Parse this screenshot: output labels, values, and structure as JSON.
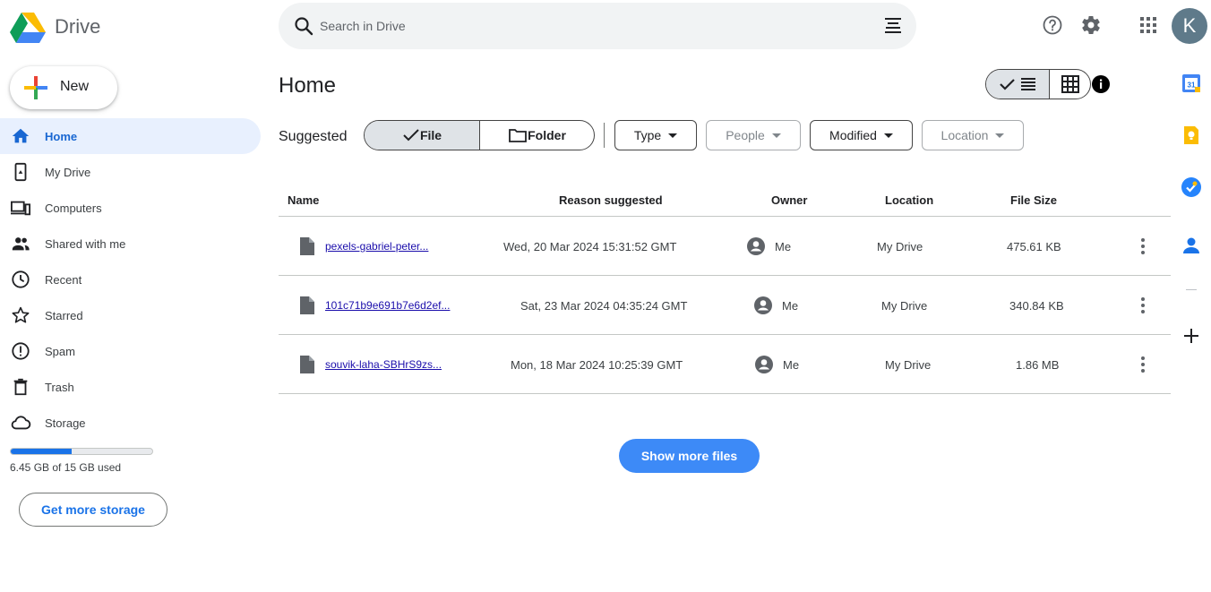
{
  "header": {
    "app_name": "Drive",
    "search_placeholder": "Search in Drive",
    "avatar_initial": "K"
  },
  "sidebar": {
    "new_label": "New",
    "items": [
      {
        "label": "Home",
        "icon": "home-icon",
        "active": true
      },
      {
        "label": "My Drive",
        "icon": "my-drive-icon"
      },
      {
        "label": "Computers",
        "icon": "computers-icon"
      },
      {
        "label": "Shared with me",
        "icon": "people-icon"
      },
      {
        "label": "Recent",
        "icon": "clock-icon"
      },
      {
        "label": "Starred",
        "icon": "star-icon"
      },
      {
        "label": "Spam",
        "icon": "spam-icon"
      },
      {
        "label": "Trash",
        "icon": "trash-icon"
      },
      {
        "label": "Storage",
        "icon": "cloud-icon"
      }
    ],
    "storage": {
      "used_fraction": 0.43,
      "text": "6.45 GB of 15 GB used",
      "get_more_label": "Get more storage"
    }
  },
  "main": {
    "title": "Home",
    "suggested_label": "Suggested",
    "segment": {
      "file": "File",
      "folder": "Folder"
    },
    "filters": [
      {
        "label": "Type",
        "enabled": true
      },
      {
        "label": "People",
        "enabled": false
      },
      {
        "label": "Modified",
        "enabled": true
      },
      {
        "label": "Location",
        "enabled": false
      }
    ],
    "columns": [
      "Name",
      "Reason suggested",
      "Owner",
      "Location",
      "File Size"
    ],
    "rows": [
      {
        "name": "pexels-gabriel-peter...",
        "reason": "Wed, 20 Mar 2024 15:31:52 GMT",
        "owner": "Me",
        "location": "My Drive",
        "size": "475.61 KB"
      },
      {
        "name": "101c71b9e691b7e6d2ef...",
        "reason": "Sat, 23 Mar 2024 04:35:24 GMT",
        "owner": "Me",
        "location": "My Drive",
        "size": "340.84 KB"
      },
      {
        "name": "souvik-laha-SBHrS9zs...",
        "reason": "Mon, 18 Mar 2024 10:25:39 GMT",
        "owner": "Me",
        "location": "My Drive",
        "size": "1.86 MB"
      }
    ],
    "show_more_label": "Show more files"
  },
  "side_panel": {
    "calendar_day": "31",
    "icons": [
      "calendar-icon",
      "keep-icon",
      "tasks-icon",
      "contacts-icon",
      "add-icon"
    ]
  },
  "colors": {
    "accent": "#1a73e8",
    "active_nav_bg": "#e8f0fe",
    "show_more_bg": "#3d8af7"
  }
}
